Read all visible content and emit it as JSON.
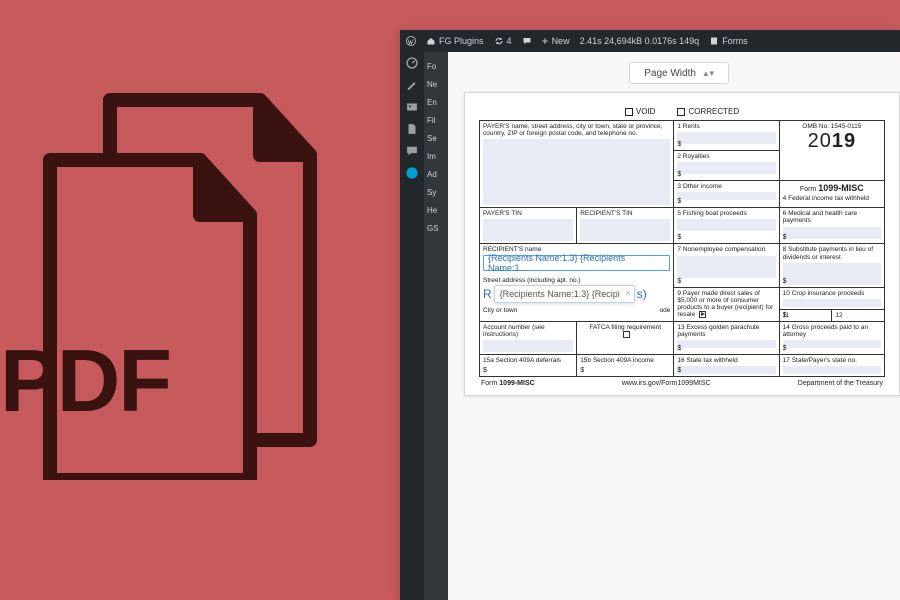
{
  "pdf_label": "PDF",
  "adminbar": {
    "site": "FG Plugins",
    "updates": "4",
    "comments": "",
    "new": "New",
    "stats": "2.41s  24,694kB  0.0176s  149q",
    "forms": "Forms"
  },
  "sidebar_sub": [
    "Fo",
    "Ne",
    "En",
    "Fil",
    "Se",
    "Im",
    "Ad",
    "Sy",
    "He",
    "GS"
  ],
  "zoom": "Page Width",
  "checks": {
    "void": "VOID",
    "corrected": "CORRECTED"
  },
  "cells": {
    "payer": "PAYER'S name, street address, city or town, state or province, country, ZIP or foreign postal code, and telephone no.",
    "b1": "1 Rents",
    "omb": "OMB No. 1545-0115",
    "year": "2019",
    "formline": "Form 1099-MISC",
    "b2": "2 Royalties",
    "b3": "3 Other income",
    "b4": "4 Federal income tax withheld",
    "ptin": "PAYER'S TIN",
    "rtin": "RECIPIENT'S TIN",
    "b5": "5 Fishing boat proceeds",
    "b6": "6 Medical and health care payments",
    "rname": "RECIPIENT'S name",
    "merge_name": "{Recipients Name:1.3} {Recipients Name:1...",
    "street": "Street address (including apt. no.)",
    "merge_street_a": "R",
    "merge_street_b": "s)",
    "tooltip": "{Recipients Name:1.3} {Recipi",
    "city": "City or town",
    "citycode": "ode",
    "b7": "7 Nonemployee compensation",
    "b8": "8 Substitute payments in lieu of dividends or interest",
    "b9": "9 Payer made direct sales of $5,000 or more of consumer products to a buyer (recipient) for resale",
    "b10": "10 Crop insurance proceeds",
    "b11": "11",
    "b12": "12",
    "acct": "Account number (see instructions)",
    "fatca": "FATCA filing requirement",
    "b13": "13 Excess golden parachute payments",
    "b14": "14 Gross proceeds paid to an attorney",
    "b15a": "15a Section 409A deferrals",
    "b15b": "15b Section 409A income",
    "b16": "16 State tax withheld",
    "b17": "17 State/Payer's state no."
  },
  "footer": {
    "left": "Form 1099-MISC",
    "center": "www.irs.gov/Form1099MISC",
    "right": "Department of the Treasury"
  }
}
